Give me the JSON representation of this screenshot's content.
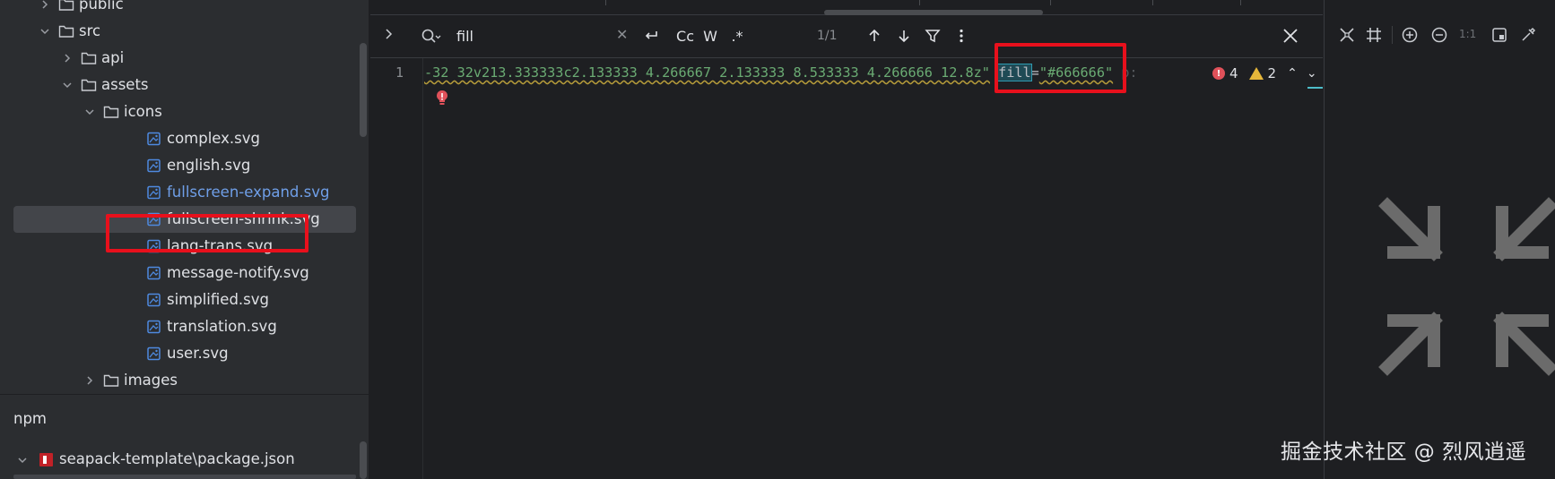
{
  "project_tree": {
    "items": [
      {
        "label": "public",
        "level": 1,
        "kind": "folder",
        "state": "collapsed"
      },
      {
        "label": "src",
        "level": 1,
        "kind": "folder",
        "state": "expanded"
      },
      {
        "label": "api",
        "level": 2,
        "kind": "folder",
        "state": "collapsed"
      },
      {
        "label": "assets",
        "level": 2,
        "kind": "folder",
        "state": "expanded"
      },
      {
        "label": "icons",
        "level": 3,
        "kind": "folder",
        "state": "expanded"
      },
      {
        "label": "complex.svg",
        "level": 4,
        "kind": "svg-file"
      },
      {
        "label": "english.svg",
        "level": 4,
        "kind": "svg-file"
      },
      {
        "label": "fullscreen-expand.svg",
        "level": 4,
        "kind": "svg-file",
        "modified": true
      },
      {
        "label": "fullscreen-shrink.svg",
        "level": 4,
        "kind": "svg-file",
        "selected": true
      },
      {
        "label": "lang-trans.svg",
        "level": 4,
        "kind": "svg-file"
      },
      {
        "label": "message-notify.svg",
        "level": 4,
        "kind": "svg-file"
      },
      {
        "label": "simplified.svg",
        "level": 4,
        "kind": "svg-file"
      },
      {
        "label": "translation.svg",
        "level": 4,
        "kind": "svg-file"
      },
      {
        "label": "user.svg",
        "level": 4,
        "kind": "svg-file"
      },
      {
        "label": "images",
        "level": 3,
        "kind": "folder",
        "state": "collapsed"
      }
    ]
  },
  "npm": {
    "title": "npm",
    "package": "seapack-template\\package.json"
  },
  "find_bar": {
    "query": "fill",
    "match_case_label": "Cc",
    "words_label": "W",
    "regex_label": ".*",
    "count": "1/1"
  },
  "editor": {
    "line_number": "1",
    "code_before": "-32 32v213.333333c2.133333 4.266667 2.133333 8.533333 4.266666 12.8z\"",
    "code_attr": "fill",
    "code_eq": "=",
    "code_value": "\"#666666\"",
    "code_after": " p:",
    "errors": "4",
    "warnings": "2"
  },
  "preview": {
    "ratio_label": "1:1"
  },
  "watermark": "掘金技术社区 @ 烈风逍遥",
  "colors": {
    "highlight_box": "#e8101c",
    "string": "#6aab73",
    "modified_file": "#6f9fe8",
    "selection": "#43454a",
    "preview_icon": "#6b6b6b"
  }
}
